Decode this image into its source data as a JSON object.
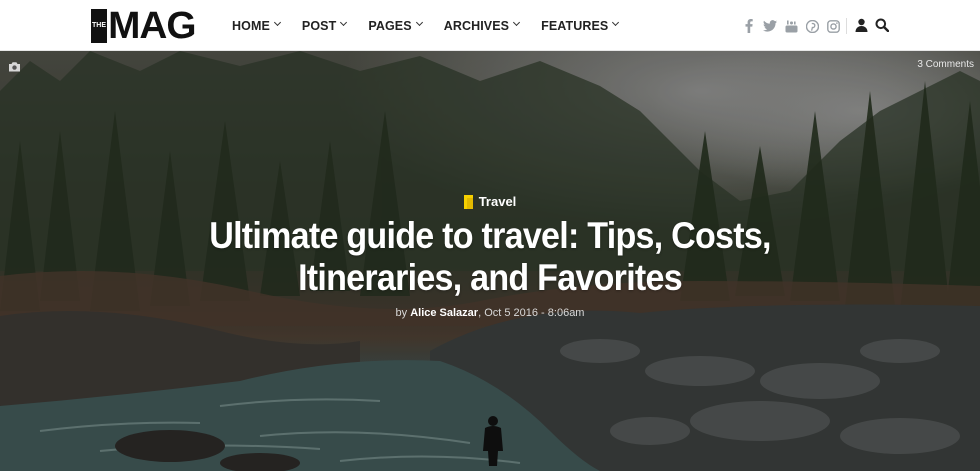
{
  "logo": {
    "the": "THE",
    "mag": "MAG"
  },
  "nav": [
    {
      "label": "HOME"
    },
    {
      "label": "POST"
    },
    {
      "label": "PAGES"
    },
    {
      "label": "ARCHIVES"
    },
    {
      "label": "FEATURES"
    }
  ],
  "social_icons": [
    "facebook-icon",
    "twitter-icon",
    "youtube-icon",
    "pinterest-icon",
    "instagram-icon"
  ],
  "hero": {
    "comments": "3 Comments",
    "category": "Travel",
    "title_line1": "Ultimate guide to travel: Tips, Costs,",
    "title_line2": "Itineraries, and Favorites",
    "by": "by",
    "author": "Alice Salazar",
    "date": ", Oct 5 2016 - 8:06am"
  },
  "colors": {
    "accent": "#f6d000",
    "icon_gray": "#9aa0a6",
    "text": "#222222"
  }
}
